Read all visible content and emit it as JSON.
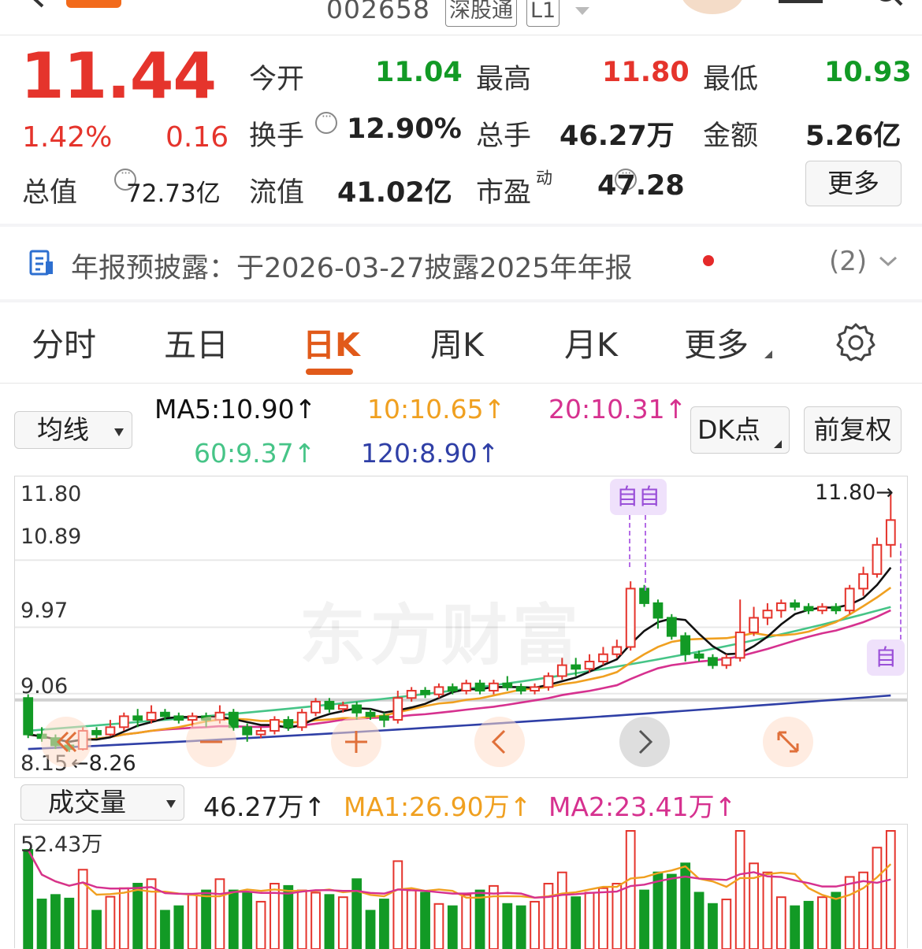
{
  "header": {
    "stock_code": "002658",
    "badge_sz": "深股通",
    "badge_level": "L1"
  },
  "quote": {
    "price": "11.44",
    "change_pct": "1.42%",
    "change_amt": "0.16",
    "open_label": "今开",
    "open": "11.04",
    "high_label": "最高",
    "high": "11.80",
    "low_label": "最低",
    "low": "10.93",
    "turnover_label": "换手",
    "turnover": "12.90%",
    "volume_label": "总手",
    "volume": "46.27万",
    "amount_label": "金额",
    "amount": "5.26亿",
    "mktcap_label": "总值",
    "mktcap": "72.73亿",
    "float_label": "流值",
    "float_cap": "41.02亿",
    "pe_label": "市盈",
    "pe_sup": "动",
    "pe": "47.28",
    "more_button": "更多"
  },
  "notice": {
    "text": "年报预披露：于2026-03-27披露2025年年报",
    "count": "(2)"
  },
  "tabs": [
    "分时",
    "五日",
    "日K",
    "周K",
    "月K",
    "更多"
  ],
  "active_tab": "日K",
  "ma_bar": {
    "selector": "均线",
    "ma5": "MA5:10.90↑",
    "ma10": "10:10.65↑",
    "ma20": "20:10.31↑",
    "ma60": "60:9.37↑",
    "ma120": "120:8.90↑",
    "dk_button": "DK点",
    "fq_button": "前复权"
  },
  "kline": {
    "y_labels": [
      "11.80",
      "10.89",
      "9.97",
      "9.06",
      "8.15"
    ],
    "high_marker": "11.80→",
    "low_marker": "←8.26",
    "badge": "自",
    "watermark": "东方财富"
  },
  "volume_bar": {
    "selector": "成交量",
    "vol": "46.27万↑",
    "ma1": "MA1:26.90万↑",
    "ma2": "MA2:23.41万↑",
    "max_label": "52.43万"
  },
  "colors": {
    "up": "#e5342c",
    "down": "#129a25",
    "ma5": "#111111",
    "ma10": "#f0a020",
    "ma20": "#d6318f",
    "ma60": "#46c487",
    "ma120": "#2f3fa6",
    "accent": "#e15a1a"
  },
  "chart_data": {
    "type": "candlestick",
    "ylim": [
      8.15,
      11.8
    ],
    "candles": [
      [
        9.0,
        8.5,
        9.05,
        8.45
      ],
      [
        8.5,
        8.45,
        8.6,
        8.4
      ],
      [
        8.45,
        8.35,
        8.5,
        8.3
      ],
      [
        8.35,
        8.3,
        8.4,
        8.26
      ],
      [
        8.3,
        8.55,
        8.6,
        8.28
      ],
      [
        8.55,
        8.5,
        8.6,
        8.45
      ],
      [
        8.5,
        8.6,
        8.7,
        8.48
      ],
      [
        8.6,
        8.75,
        8.8,
        8.55
      ],
      [
        8.75,
        8.7,
        8.85,
        8.6
      ],
      [
        8.7,
        8.8,
        8.9,
        8.65
      ],
      [
        8.8,
        8.75,
        8.85,
        8.7
      ],
      [
        8.75,
        8.7,
        8.8,
        8.65
      ],
      [
        8.7,
        8.75,
        8.8,
        8.6
      ],
      [
        8.75,
        8.7,
        8.8,
        8.6
      ],
      [
        8.7,
        8.8,
        8.9,
        8.65
      ],
      [
        8.8,
        8.6,
        8.85,
        8.55
      ],
      [
        8.6,
        8.5,
        8.65,
        8.4
      ],
      [
        8.5,
        8.55,
        8.6,
        8.45
      ],
      [
        8.55,
        8.7,
        8.75,
        8.5
      ],
      [
        8.7,
        8.6,
        8.75,
        8.55
      ],
      [
        8.6,
        8.8,
        8.85,
        8.55
      ],
      [
        8.8,
        8.95,
        9.0,
        8.75
      ],
      [
        8.95,
        8.85,
        9.0,
        8.8
      ],
      [
        8.85,
        8.9,
        8.95,
        8.8
      ],
      [
        8.9,
        8.8,
        8.95,
        8.7
      ],
      [
        8.8,
        8.75,
        8.85,
        8.7
      ],
      [
        8.75,
        8.7,
        8.8,
        8.6
      ],
      [
        8.7,
        9.0,
        9.1,
        8.65
      ],
      [
        9.0,
        9.1,
        9.15,
        8.95
      ],
      [
        9.1,
        9.05,
        9.15,
        9.0
      ],
      [
        9.05,
        9.15,
        9.2,
        9.0
      ],
      [
        9.15,
        9.1,
        9.2,
        9.05
      ],
      [
        9.1,
        9.2,
        9.25,
        9.05
      ],
      [
        9.2,
        9.1,
        9.25,
        9.05
      ],
      [
        9.1,
        9.2,
        9.25,
        9.05
      ],
      [
        9.2,
        9.15,
        9.3,
        9.1
      ],
      [
        9.15,
        9.1,
        9.2,
        9.05
      ],
      [
        9.1,
        9.15,
        9.2,
        9.05
      ],
      [
        9.15,
        9.3,
        9.35,
        9.1
      ],
      [
        9.3,
        9.45,
        9.55,
        9.25
      ],
      [
        9.45,
        9.4,
        9.55,
        9.3
      ],
      [
        9.4,
        9.5,
        9.6,
        9.35
      ],
      [
        9.5,
        9.6,
        9.7,
        9.45
      ],
      [
        9.6,
        9.7,
        9.8,
        9.55
      ],
      [
        9.7,
        10.5,
        10.6,
        9.65
      ],
      [
        10.5,
        10.3,
        10.55,
        10.25
      ],
      [
        10.3,
        10.1,
        10.35,
        9.95
      ],
      [
        10.1,
        9.85,
        10.15,
        9.8
      ],
      [
        9.85,
        9.6,
        9.9,
        9.5
      ],
      [
        9.6,
        9.55,
        9.65,
        9.5
      ],
      [
        9.55,
        9.45,
        9.6,
        9.4
      ],
      [
        9.45,
        9.55,
        9.6,
        9.4
      ],
      [
        9.55,
        9.9,
        10.35,
        9.5
      ],
      [
        9.9,
        10.1,
        10.25,
        9.85
      ],
      [
        10.1,
        10.2,
        10.3,
        10.0
      ],
      [
        10.2,
        10.3,
        10.35,
        10.1
      ],
      [
        10.3,
        10.25,
        10.35,
        10.2
      ],
      [
        10.25,
        10.2,
        10.3,
        10.15
      ],
      [
        10.2,
        10.25,
        10.3,
        10.15
      ],
      [
        10.25,
        10.2,
        10.3,
        10.15
      ],
      [
        10.2,
        10.5,
        10.55,
        10.15
      ],
      [
        10.5,
        10.7,
        10.8,
        10.4
      ],
      [
        10.7,
        11.1,
        11.2,
        10.65
      ],
      [
        11.1,
        11.44,
        11.8,
        10.93
      ]
    ],
    "volume_max": 52.43
  }
}
